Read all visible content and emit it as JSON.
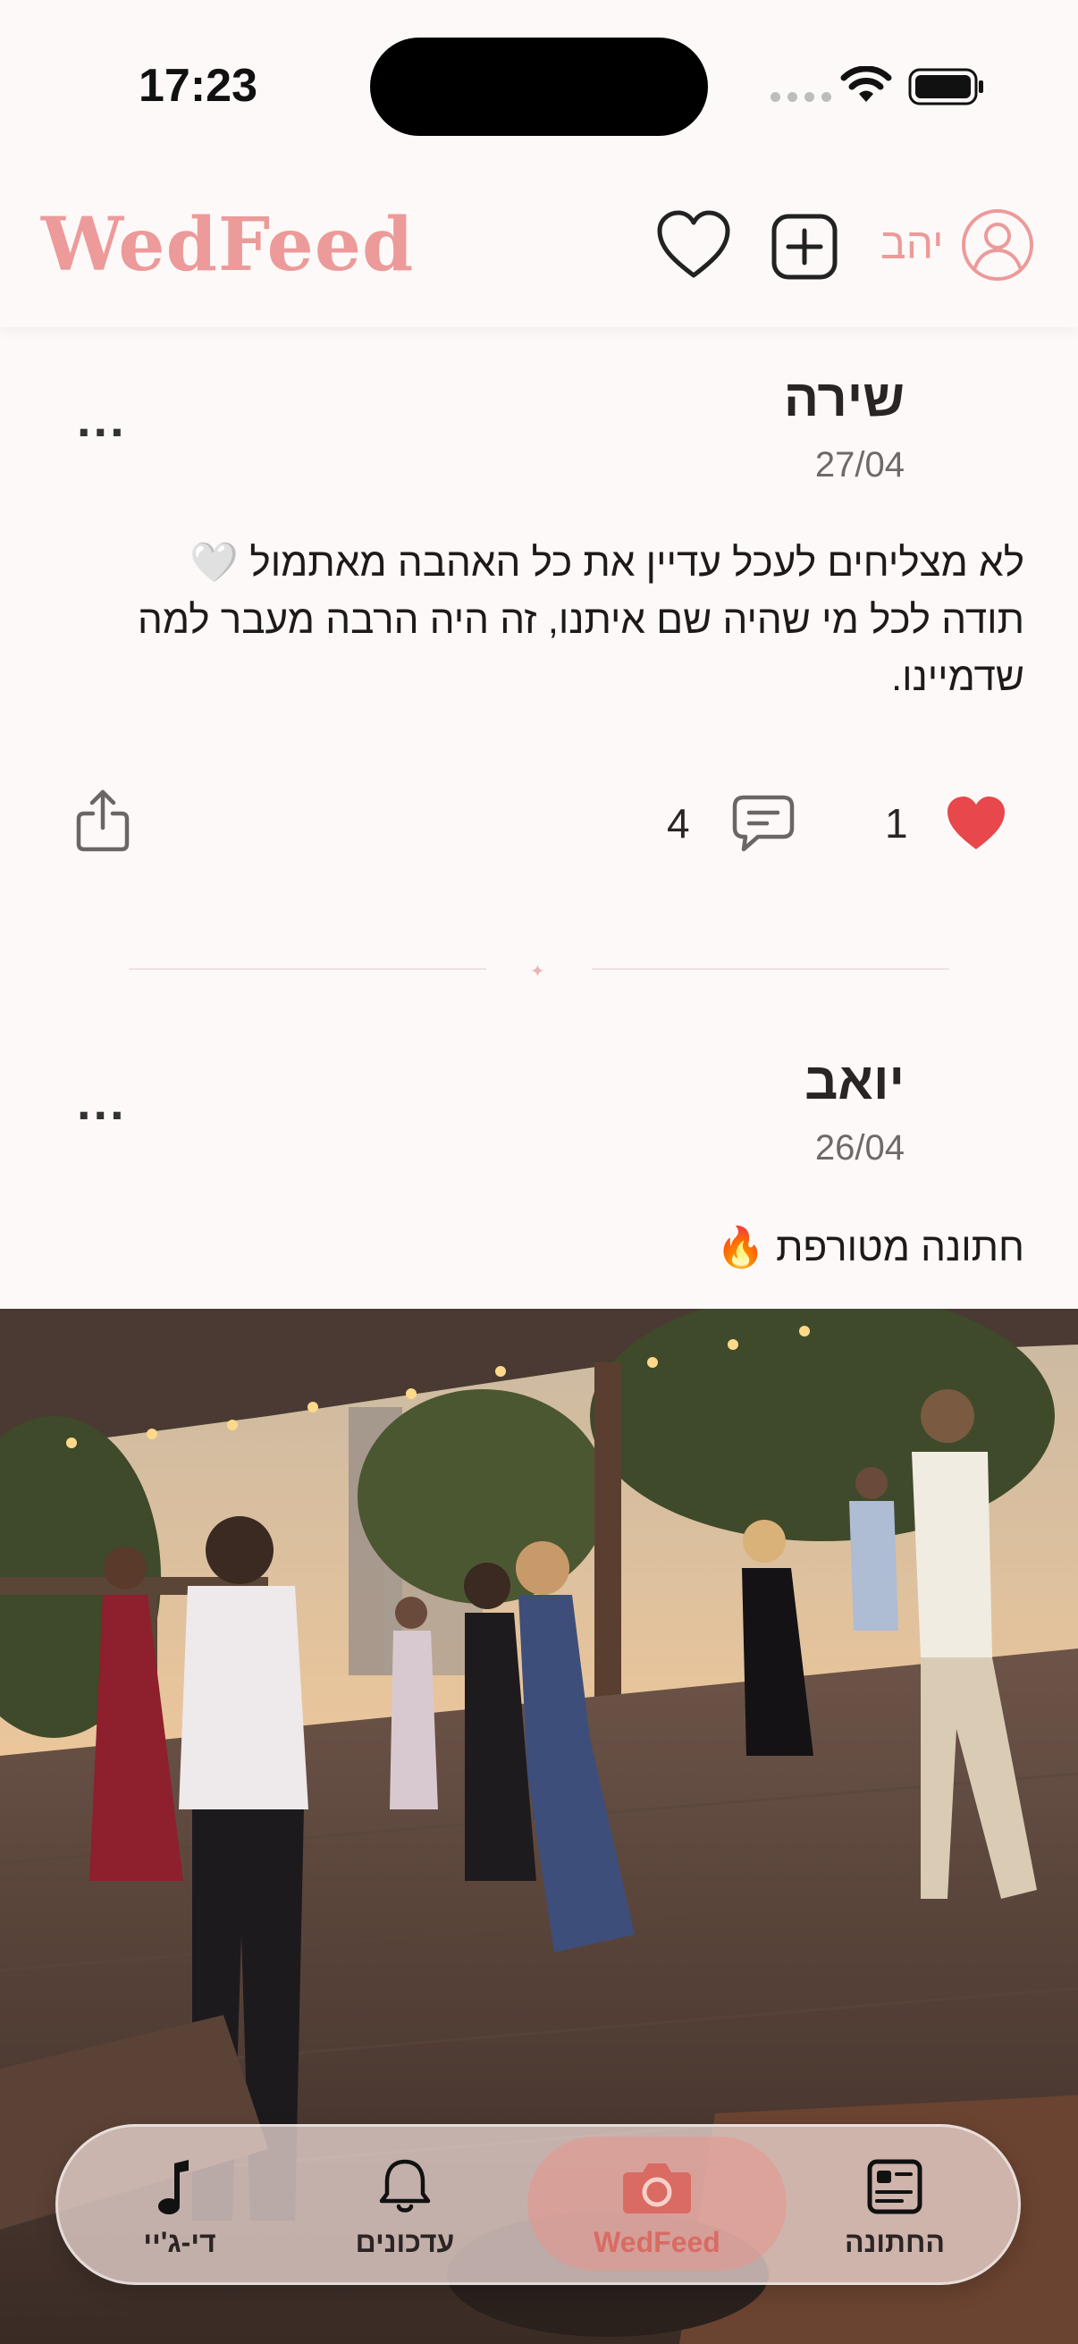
{
  "status_bar": {
    "time": "17:23"
  },
  "header": {
    "logo": "WedFeed",
    "user_name": "יהב",
    "icons": [
      "heart-icon",
      "add-square-icon",
      "user-circle-icon"
    ]
  },
  "posts": [
    {
      "author": "שירה",
      "date": "27/04",
      "text_line1": "לא מצליחים לעכל עדיין את כל האהבה מאתמול 🤍",
      "text_line2": "תודה לכל מי שהיה שם איתנו, זה היה הרבה מעבר למה",
      "text_line3": "שדמיינו.",
      "likes": "1",
      "comments": "4",
      "more": "..."
    },
    {
      "author": "יואב",
      "date": "26/04",
      "text": "חתונה מטורפת 🔥",
      "more": "..."
    }
  ],
  "tabbar": {
    "tabs": [
      {
        "label": "החתונה",
        "icon": "id-card-icon"
      },
      {
        "label": "WedFeed",
        "icon": "camera-icon",
        "active": true
      },
      {
        "label": "עדכונים",
        "icon": "bell-icon"
      },
      {
        "label": "די-ג'יי",
        "icon": "music-note-icon"
      }
    ]
  },
  "colors": {
    "background": "#fdf9f8",
    "accent": "#ec9a9a",
    "like": "#e8474b",
    "tab_active": "#d96b63"
  }
}
